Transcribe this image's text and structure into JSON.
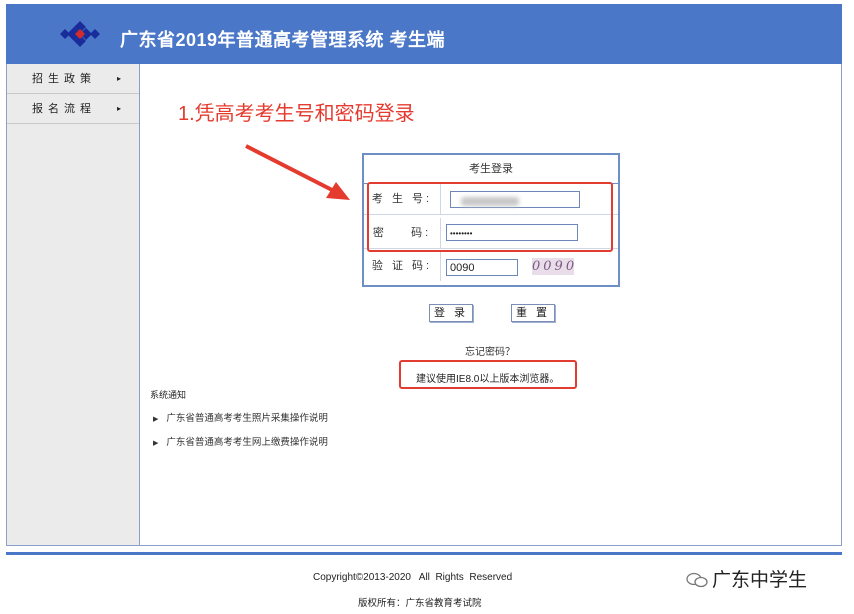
{
  "header": {
    "title": "广东省2019年普通高考管理系统  考生端"
  },
  "sidebar": {
    "items": [
      {
        "label": "招生政策",
        "arrow": "▸"
      },
      {
        "label": "报名流程",
        "arrow": "▸"
      }
    ]
  },
  "annotation": {
    "text": "1.凭高考考生号和密码登录"
  },
  "login": {
    "title": "考生登录",
    "candidate_label": "考 生 号:",
    "password_label": "密    码:",
    "password_value": "••••••••",
    "captcha_label": "验 证 码:",
    "captcha_value": "0090",
    "captcha_image_text": "0090",
    "login_button": "登 录",
    "reset_button": "重 置",
    "forgot": "忘记密码？"
  },
  "browser_tip": "建议使用IE8.0以上版本浏览器。",
  "notices": {
    "title": "系统通知",
    "items": [
      "广东省普通高考考生照片采集操作说明",
      "广东省普通高考考生网上缴费操作说明"
    ]
  },
  "footer": {
    "copyright": "Copyright©2013-2020   All  Rights  Reserved",
    "owner": "版权所有：广东省教育考试院",
    "watermark": "广东中学生"
  },
  "colors": {
    "header": "#4a77c8",
    "annotation": "#e53a2e"
  }
}
